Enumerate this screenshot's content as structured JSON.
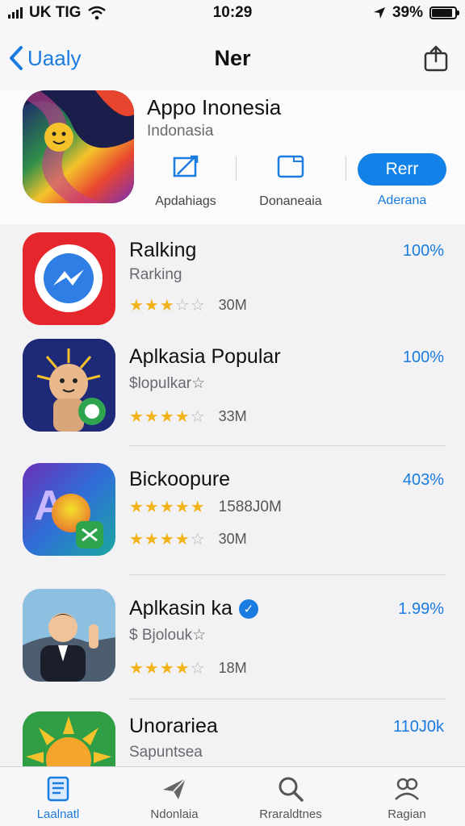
{
  "status_bar": {
    "carrier": "UK TIG",
    "time": "10:29",
    "battery": "39%",
    "battery_level": 0.9
  },
  "nav": {
    "back_label": "Uaaly",
    "title": "Ner"
  },
  "hero": {
    "title": "Appo Inonesia",
    "subtitle": "Indonasia",
    "actions": [
      {
        "label": "Apdahiags",
        "icon": "edit-icon"
      },
      {
        "label": "Donaneaia",
        "icon": "folder-icon"
      }
    ],
    "get_button": "Rerr",
    "get_label": "Aderana"
  },
  "apps": [
    {
      "title": "Ralking",
      "subtitle": "Rarking",
      "rating": 3,
      "count": "30M",
      "percent": "100%",
      "icon": "messenger-icon"
    },
    {
      "title": "Aplkasia Popular",
      "subtitle": "$lopulkar☆",
      "rating": 4,
      "count": "33M",
      "percent": "100%",
      "icon": "sun-creature-icon"
    },
    {
      "title": "Bickoopure",
      "subtitle": "1588J0M",
      "rating": 5,
      "rating2": 4,
      "count": "30M",
      "percent": "403%",
      "icon": "letter-a-icon"
    },
    {
      "title": "Aplkasin ka",
      "subtitle": "$ Bjolouk☆",
      "rating": 4,
      "count": "18M",
      "percent": "1.99%",
      "icon": "man-waving-icon",
      "verified": true
    },
    {
      "title": "Unorariea",
      "subtitle": "Sapuntsea",
      "percent": "110J0k",
      "icon": "sun-icon"
    }
  ],
  "tabs": [
    {
      "label": "Laalnatl",
      "icon": "today-icon",
      "active": true
    },
    {
      "label": "Ndonlaia",
      "icon": "paper-plane-icon",
      "active": false
    },
    {
      "label": "Rraraldtnes",
      "icon": "search-icon",
      "active": false
    },
    {
      "label": "Ragian",
      "icon": "account-icon",
      "active": false
    }
  ]
}
